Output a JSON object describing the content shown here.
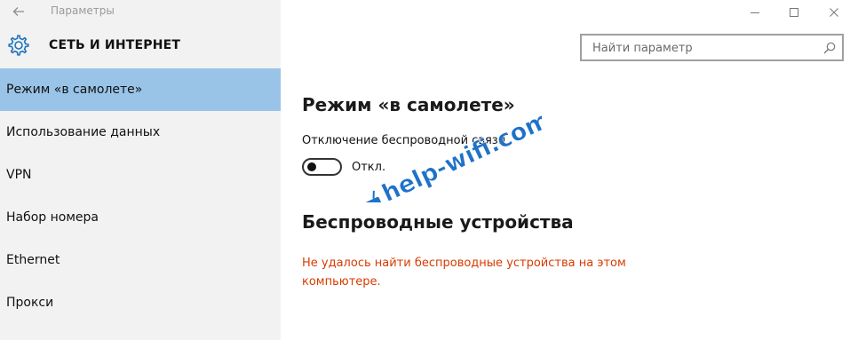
{
  "window": {
    "title": "Параметры",
    "back_icon": "arrow-left-icon",
    "controls": [
      "minimize-icon",
      "maximize-icon",
      "close-icon"
    ]
  },
  "header": {
    "icon": "gear-icon",
    "title": "СЕТЬ И ИНТЕРНЕТ",
    "search": {
      "placeholder": "Найти параметр",
      "value": ""
    }
  },
  "sidebar": {
    "items": [
      {
        "label": "Режим «в самолете»",
        "active": true
      },
      {
        "label": "Использование данных",
        "active": false
      },
      {
        "label": "VPN",
        "active": false
      },
      {
        "label": "Набор номера",
        "active": false
      },
      {
        "label": "Ethernet",
        "active": false
      },
      {
        "label": "Прокси",
        "active": false
      }
    ]
  },
  "main": {
    "airplane": {
      "title": "Режим «в самолете»",
      "toggle_label": "Отключение беспроводной связи",
      "toggle_state": "Откл.",
      "toggle_on": false
    },
    "wireless": {
      "title": "Беспроводные устройства",
      "error": "Не удалось найти беспроводные устройства на этом компьютере."
    }
  },
  "watermark": {
    "text": "help-wifi.com"
  },
  "colors": {
    "sidebar_bg": "#f2f2f2",
    "active_item": "#99c4e8",
    "error": "#d83b01",
    "watermark": "#1e72c8"
  }
}
